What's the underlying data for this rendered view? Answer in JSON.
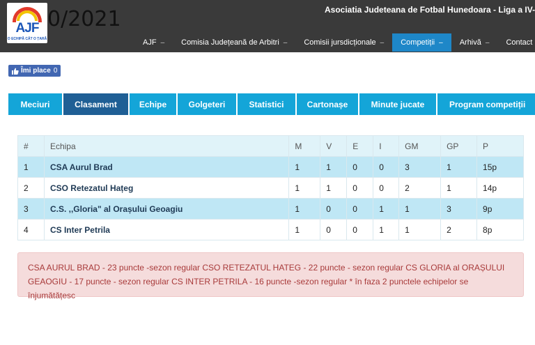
{
  "header": {
    "season_fragment": "0/2021",
    "site_title": "Asociatia Judeteana de Fotbal Hunedoara - Liga a IV-a,",
    "logo_text": "AJF",
    "logo_tagline": "O ECHIPĂ CÂT O ȚARĂ"
  },
  "nav": [
    {
      "label": "AJF",
      "has_caret": true
    },
    {
      "label": "Comisia Județeană de Arbitri",
      "has_caret": true
    },
    {
      "label": "Comisii jursdicționale",
      "has_caret": true
    },
    {
      "label": "Competiții",
      "has_caret": true,
      "active": true
    },
    {
      "label": "Arhivă",
      "has_caret": true
    },
    {
      "label": "Contact",
      "has_caret": false
    }
  ],
  "like_button": {
    "label": "Îmi place",
    "count": "0"
  },
  "tabs": [
    {
      "label": "Meciuri"
    },
    {
      "label": "Clasament",
      "active": true
    },
    {
      "label": "Echipe"
    },
    {
      "label": "Golgeteri"
    },
    {
      "label": "Statistici"
    },
    {
      "label": "Cartonașe"
    },
    {
      "label": "Minute jucate"
    },
    {
      "label": "Program competiții"
    }
  ],
  "standings": {
    "columns": [
      "#",
      "Echipa",
      "M",
      "V",
      "E",
      "I",
      "GM",
      "GP",
      "P"
    ],
    "rows": [
      [
        "1",
        "CSA Aurul Brad",
        "1",
        "1",
        "0",
        "0",
        "3",
        "1",
        "15p"
      ],
      [
        "2",
        "CSO Retezatul Hațeg",
        "1",
        "1",
        "0",
        "0",
        "2",
        "1",
        "14p"
      ],
      [
        "3",
        "C.S. ,,Gloria\" al Orașului Geoagiu",
        "1",
        "0",
        "0",
        "1",
        "1",
        "3",
        "9p"
      ],
      [
        "4",
        "CS Inter Petrila",
        "1",
        "0",
        "0",
        "1",
        "1",
        "2",
        "8p"
      ]
    ]
  },
  "notice": "CSA AURUL BRAD - 23 puncte -sezon regular CSO RETEZATUL HATEG - 22 puncte - sezon regular CS GLORIA al ORAȘULUI GEAOGIU - 17 puncte - sezon regular CS INTER PETRILA - 16 puncte -sezon regular * în faza 2 punctele echipelor se înjumătățesc",
  "colors": {
    "header_bg": "#3a3a3a",
    "nav_active": "#1e87c8",
    "tab": "#14a5d8",
    "tab_active": "#1f5f95",
    "row_highlight": "#bfe7f5",
    "alert_bg": "#f5dcdc",
    "alert_text": "#a83a3a",
    "like_bg": "#4267b2"
  },
  "icons": {
    "like": "thumbs-up-icon",
    "caret": "caret-down-icon"
  }
}
